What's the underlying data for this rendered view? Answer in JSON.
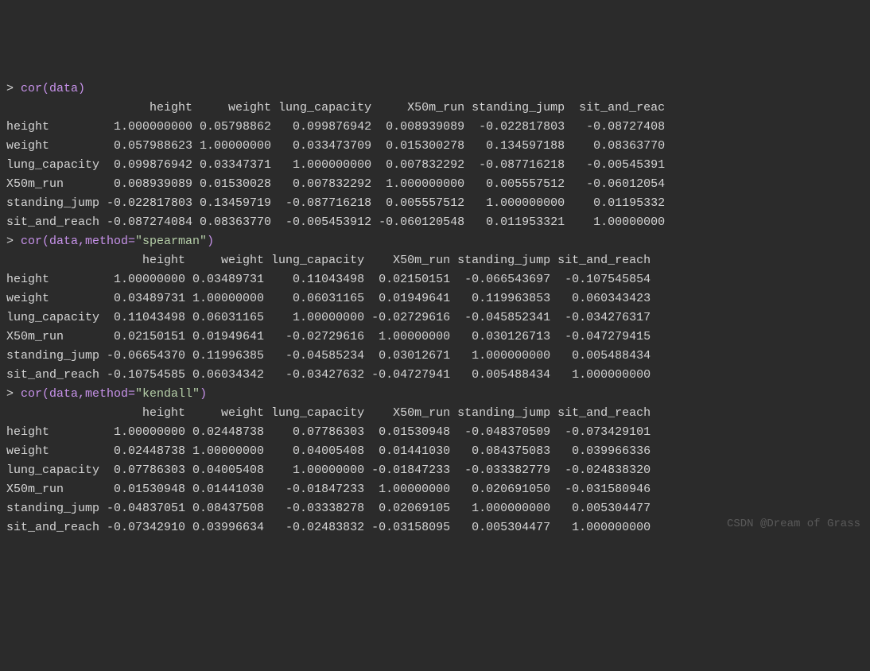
{
  "commands": {
    "cmd1": {
      "prompt": "> ",
      "text": "cor(data)"
    },
    "cmd2": {
      "prompt": "> ",
      "text": "cor(data,method=",
      "string": "\"spearman\"",
      "end": ")"
    },
    "cmd3": {
      "prompt": "> ",
      "text": "cor(data,method=",
      "string": "\"kendall\"",
      "end": ")"
    }
  },
  "output1": {
    "header": "                    height     weight lung_capacity     X50m_run standing_jump  sit_and_reac",
    "rows": [
      "height         1.000000000 0.05798862   0.099876942  0.008939089  -0.022817803   -0.08727408",
      "weight         0.057988623 1.00000000   0.033473709  0.015300278   0.134597188    0.08363770",
      "lung_capacity  0.099876942 0.03347371   1.000000000  0.007832292  -0.087716218   -0.00545391",
      "X50m_run       0.008939089 0.01530028   0.007832292  1.000000000   0.005557512   -0.06012054",
      "standing_jump -0.022817803 0.13459719  -0.087716218  0.005557512   1.000000000    0.01195332",
      "sit_and_reach -0.087274084 0.08363770  -0.005453912 -0.060120548   0.011953321    1.00000000"
    ]
  },
  "output2": {
    "header": "                   height     weight lung_capacity    X50m_run standing_jump sit_and_reach",
    "rows": [
      "height         1.00000000 0.03489731    0.11043498  0.02150151  -0.066543697  -0.107545854",
      "weight         0.03489731 1.00000000    0.06031165  0.01949641   0.119963853   0.060343423",
      "lung_capacity  0.11043498 0.06031165    1.00000000 -0.02729616  -0.045852341  -0.034276317",
      "X50m_run       0.02150151 0.01949641   -0.02729616  1.00000000   0.030126713  -0.047279415",
      "standing_jump -0.06654370 0.11996385   -0.04585234  0.03012671   1.000000000   0.005488434",
      "sit_and_reach -0.10754585 0.06034342   -0.03427632 -0.04727941   0.005488434   1.000000000"
    ]
  },
  "output3": {
    "header": "                   height     weight lung_capacity    X50m_run standing_jump sit_and_reach",
    "rows": [
      "height         1.00000000 0.02448738    0.07786303  0.01530948  -0.048370509  -0.073429101",
      "weight         0.02448738 1.00000000    0.04005408  0.01441030   0.084375083   0.039966336",
      "lung_capacity  0.07786303 0.04005408    1.00000000 -0.01847233  -0.033382779  -0.024838320",
      "X50m_run       0.01530948 0.01441030   -0.01847233  1.00000000   0.020691050  -0.031580946",
      "standing_jump -0.04837051 0.08437508   -0.03338278  0.02069105   1.000000000   0.005304477",
      "sit_and_reach -0.07342910 0.03996634   -0.02483832 -0.03158095   0.005304477   1.000000000"
    ]
  },
  "watermark": "CSDN @Dream of Grass"
}
